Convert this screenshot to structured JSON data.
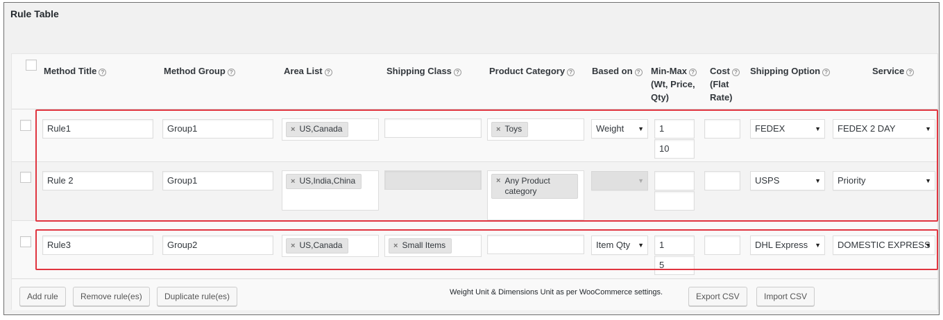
{
  "title": "Rule Table",
  "header": {
    "method_title": "Method Title",
    "method_group": "Method Group",
    "area_list": "Area List",
    "shipping_class": "Shipping Class",
    "product_category": "Product Category",
    "based_on": "Based on",
    "min_max_1": "Min-Max",
    "min_max_2": "(Wt, Price,",
    "min_max_3": "Qty)",
    "cost_1": "Cost",
    "cost_2": "(Flat",
    "cost_3": "Rate)",
    "shipping_option": "Shipping Option",
    "service": "Service",
    "help_glyph": "?"
  },
  "rows": [
    {
      "method_title": "Rule1",
      "method_group": "Group1",
      "area": "US,Canada",
      "shipping_class": "",
      "product_category": "Toys",
      "based_on": "Weight",
      "min": "1",
      "max": "10",
      "cost": "",
      "shipping_option": "FEDEX",
      "service": "FEDEX 2 DAY"
    },
    {
      "method_title": "Rule 2",
      "method_group": "Group1",
      "area": "US,India,China",
      "shipping_class": "",
      "product_category_line1": "Any Product",
      "product_category_line2": "category",
      "based_on": "",
      "min": "",
      "max": "",
      "cost": "",
      "shipping_option": "USPS",
      "service": "Priority"
    },
    {
      "method_title": "Rule3",
      "method_group": "Group2",
      "area": "US,Canada",
      "shipping_class": "Small Items",
      "product_category": "",
      "based_on": "Item Qty",
      "min": "1",
      "max": "5",
      "cost": "",
      "shipping_option": "DHL Express",
      "service": "DOMESTIC EXPRESS"
    }
  ],
  "footer": {
    "add_rule": "Add rule",
    "remove_rules": "Remove rule(es)",
    "duplicate_rules": "Duplicate rule(es)",
    "note": "Weight Unit & Dimensions Unit as per WooCommerce settings.",
    "export_csv": "Export CSV",
    "import_csv": "Import CSV"
  },
  "icons": {
    "remove_tag": "×",
    "caret": "▼"
  },
  "colors": {
    "highlight": "#e0343f"
  }
}
